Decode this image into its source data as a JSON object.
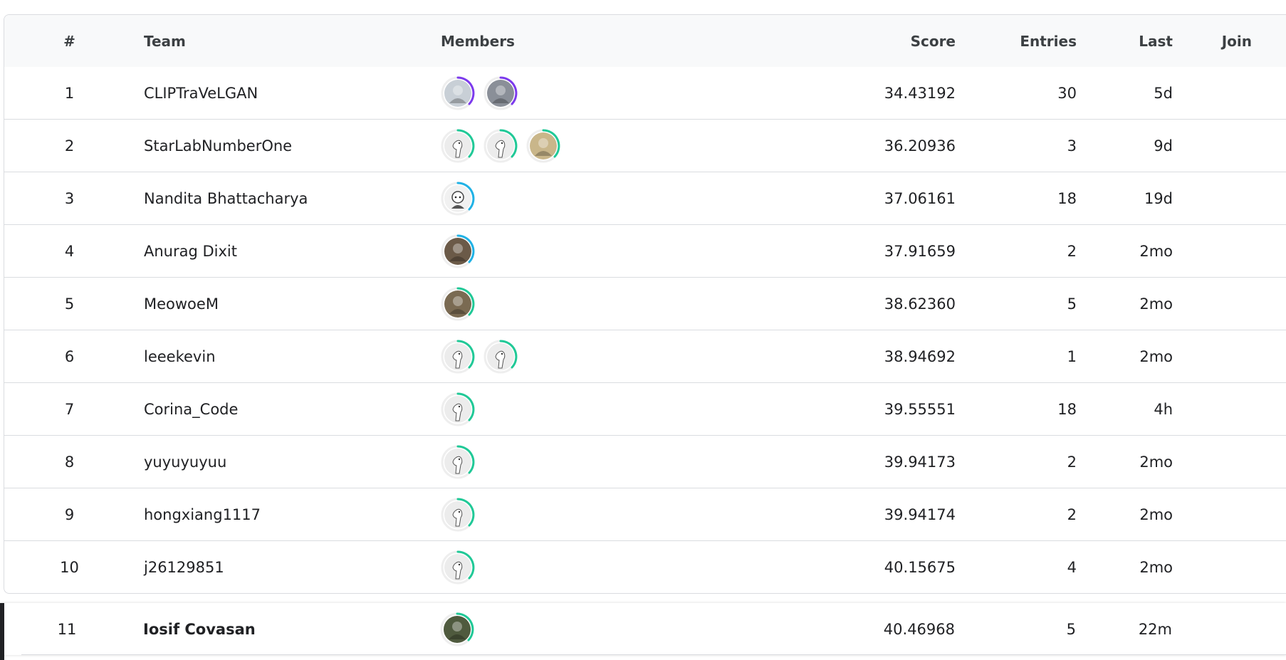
{
  "header": {
    "rank": "#",
    "team": "Team",
    "members": "Members",
    "score": "Score",
    "entries": "Entries",
    "last": "Last",
    "join": "Join"
  },
  "rows": [
    {
      "rank": "1",
      "team": "CLIPTraVeLGAN",
      "members": [
        {
          "icon": "user-photo-icon",
          "ring": "#7c3aed",
          "fill": "#c8cfd6"
        },
        {
          "icon": "user-photo-icon",
          "ring": "#7c3aed",
          "fill": "#8a8f98"
        }
      ],
      "score": "34.43192",
      "entries": "30",
      "last": "5d"
    },
    {
      "rank": "2",
      "team": "StarLabNumberOne",
      "members": [
        {
          "icon": "goose-avatar-icon",
          "ring": "#20c997",
          "fill": "#ececec"
        },
        {
          "icon": "goose-avatar-icon",
          "ring": "#20c997",
          "fill": "#ececec"
        },
        {
          "icon": "user-photo-icon",
          "ring": "#20c997",
          "fill": "#c9b68a"
        }
      ],
      "score": "36.20936",
      "entries": "3",
      "last": "9d"
    },
    {
      "rank": "3",
      "team": "Nandita Bhattacharya",
      "members": [
        {
          "icon": "user-cartoon-icon",
          "ring": "#20b2e6",
          "fill": "#f1f1f1"
        }
      ],
      "score": "37.06161",
      "entries": "18",
      "last": "19d"
    },
    {
      "rank": "4",
      "team": "Anurag Dixit",
      "members": [
        {
          "icon": "user-photo-icon",
          "ring": "#20b2e6",
          "fill": "#6b5a48"
        }
      ],
      "score": "37.91659",
      "entries": "2",
      "last": "2mo"
    },
    {
      "rank": "5",
      "team": "MeowoeM",
      "members": [
        {
          "icon": "user-photo-icon",
          "ring": "#20c997",
          "fill": "#7a6a52"
        }
      ],
      "score": "38.62360",
      "entries": "5",
      "last": "2mo"
    },
    {
      "rank": "6",
      "team": "leeekevin",
      "members": [
        {
          "icon": "goose-avatar-icon",
          "ring": "#20c997",
          "fill": "#ececec"
        },
        {
          "icon": "goose-avatar-icon",
          "ring": "#20c997",
          "fill": "#ececec"
        }
      ],
      "score": "38.94692",
      "entries": "1",
      "last": "2mo"
    },
    {
      "rank": "7",
      "team": "Corina_Code",
      "members": [
        {
          "icon": "goose-avatar-icon",
          "ring": "#20c997",
          "fill": "#ececec"
        }
      ],
      "score": "39.55551",
      "entries": "18",
      "last": "4h"
    },
    {
      "rank": "8",
      "team": "yuyuyuyuu",
      "members": [
        {
          "icon": "goose-avatar-icon",
          "ring": "#20c997",
          "fill": "#ececec"
        }
      ],
      "score": "39.94173",
      "entries": "2",
      "last": "2mo"
    },
    {
      "rank": "9",
      "team": "hongxiang1117",
      "members": [
        {
          "icon": "goose-avatar-icon",
          "ring": "#20c997",
          "fill": "#ececec"
        }
      ],
      "score": "39.94174",
      "entries": "2",
      "last": "2mo"
    },
    {
      "rank": "10",
      "team": "j26129851",
      "members": [
        {
          "icon": "goose-avatar-icon",
          "ring": "#20c997",
          "fill": "#ececec"
        }
      ],
      "score": "40.15675",
      "entries": "4",
      "last": "2mo"
    }
  ],
  "me": {
    "rank": "11",
    "team": "Iosif Covasan",
    "members": [
      {
        "icon": "user-photo-icon",
        "ring": "#20c997",
        "fill": "#4f5a3e"
      }
    ],
    "score": "40.46968",
    "entries": "5",
    "last": "22m"
  }
}
